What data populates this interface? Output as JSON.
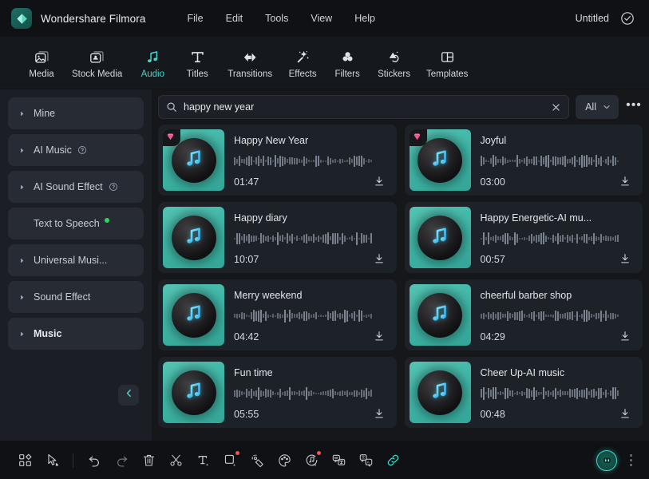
{
  "titlebar": {
    "brand": "Wondershare Filmora",
    "menus": [
      "File",
      "Edit",
      "Tools",
      "View",
      "Help"
    ],
    "doc_title": "Untitled",
    "status_icon": "check-circle-icon",
    "logo_icon": "filmora-logo-icon"
  },
  "toolbar": {
    "tabs": [
      {
        "label": "Media",
        "icon": "media-image-icon",
        "active": false
      },
      {
        "label": "Stock Media",
        "icon": "stock-media-icon",
        "active": false
      },
      {
        "label": "Audio",
        "icon": "music-note-icon",
        "active": true
      },
      {
        "label": "Titles",
        "icon": "text-t-icon",
        "active": false
      },
      {
        "label": "Transitions",
        "icon": "transitions-arrows-icon",
        "active": false
      },
      {
        "label": "Effects",
        "icon": "magic-wand-icon",
        "active": false
      },
      {
        "label": "Filters",
        "icon": "filters-circles-icon",
        "active": false
      },
      {
        "label": "Stickers",
        "icon": "stickers-icon",
        "active": false
      },
      {
        "label": "Templates",
        "icon": "templates-layout-icon",
        "active": false
      }
    ],
    "active_accent": "#3ddbd0"
  },
  "sidebar": {
    "items": [
      {
        "label": "Mine",
        "expandable": true,
        "help": false,
        "new_dot": false,
        "bold": false
      },
      {
        "label": "AI Music",
        "expandable": true,
        "help": true,
        "new_dot": false,
        "bold": false
      },
      {
        "label": "AI Sound Effect",
        "expandable": true,
        "help": true,
        "new_dot": false,
        "bold": false
      },
      {
        "label": "Text to Speech",
        "expandable": false,
        "help": false,
        "new_dot": true,
        "bold": false
      },
      {
        "label": "Universal Musi...",
        "expandable": true,
        "help": false,
        "new_dot": false,
        "bold": false
      },
      {
        "label": "Sound Effect",
        "expandable": true,
        "help": false,
        "new_dot": false,
        "bold": false
      },
      {
        "label": "Music",
        "expandable": true,
        "help": false,
        "new_dot": false,
        "bold": true
      }
    ],
    "collapse_icon": "chevron-left-icon",
    "collapse_accent": "#4fd6c4"
  },
  "search": {
    "icon": "search-icon",
    "value": "happy new year",
    "placeholder": "Search",
    "clear_icon": "close-x-icon",
    "filter_label": "All",
    "filter_icon": "chevron-down-icon",
    "more_label": "•••"
  },
  "results": {
    "download_icon": "download-icon",
    "pro_badge_icon": "pro-diamond-icon",
    "cards": [
      {
        "title": "Happy New Year",
        "duration": "01:47",
        "pro": true,
        "wave_seed": 11
      },
      {
        "title": "Joyful",
        "duration": "03:00",
        "pro": true,
        "wave_seed": 23
      },
      {
        "title": "Happy diary",
        "duration": "10:07",
        "pro": false,
        "wave_seed": 37
      },
      {
        "title": "Happy Energetic-AI mu...",
        "duration": "00:57",
        "pro": false,
        "wave_seed": 41
      },
      {
        "title": "Merry weekend",
        "duration": "04:42",
        "pro": false,
        "wave_seed": 59
      },
      {
        "title": "cheerful barber shop",
        "duration": "04:29",
        "pro": false,
        "wave_seed": 67
      },
      {
        "title": "Fun time",
        "duration": "05:55",
        "pro": false,
        "wave_seed": 73
      },
      {
        "title": "Cheer Up-AI music",
        "duration": "00:48",
        "pro": false,
        "wave_seed": 89
      }
    ]
  },
  "bottombar": {
    "buttons": [
      {
        "icon": "layout-grid-icon",
        "red_dot": false,
        "teal": false,
        "sep_after": false
      },
      {
        "icon": "cursor-select-icon",
        "red_dot": false,
        "teal": false,
        "sep_after": true
      },
      {
        "icon": "undo-icon",
        "red_dot": false,
        "teal": false,
        "sep_after": false
      },
      {
        "icon": "redo-icon",
        "red_dot": false,
        "teal": false,
        "sep_after": false
      },
      {
        "icon": "trash-delete-icon",
        "red_dot": false,
        "teal": false,
        "sep_after": false
      },
      {
        "icon": "scissors-split-icon",
        "red_dot": false,
        "teal": false,
        "sep_after": false
      },
      {
        "icon": "text-tool-icon",
        "red_dot": false,
        "teal": false,
        "sep_after": false
      },
      {
        "icon": "crop-tool-icon",
        "red_dot": true,
        "teal": false,
        "sep_after": false
      },
      {
        "icon": "mask-shape-icon",
        "red_dot": false,
        "teal": false,
        "sep_after": false
      },
      {
        "icon": "color-palette-icon",
        "red_dot": false,
        "teal": false,
        "sep_after": false
      },
      {
        "icon": "ai-audio-icon",
        "red_dot": true,
        "teal": false,
        "sep_after": false
      },
      {
        "icon": "speech-to-text-icon",
        "red_dot": false,
        "teal": false,
        "sep_after": false
      },
      {
        "icon": "translate-icon",
        "red_dot": false,
        "teal": false,
        "sep_after": false
      },
      {
        "icon": "link-chain-icon",
        "red_dot": false,
        "teal": true,
        "sep_after": false
      }
    ],
    "ai_avatar_icon": "ai-assistant-avatar-icon",
    "overflow_icon": "vertical-dots-icon",
    "teal_accent": "#3ddbd0"
  }
}
